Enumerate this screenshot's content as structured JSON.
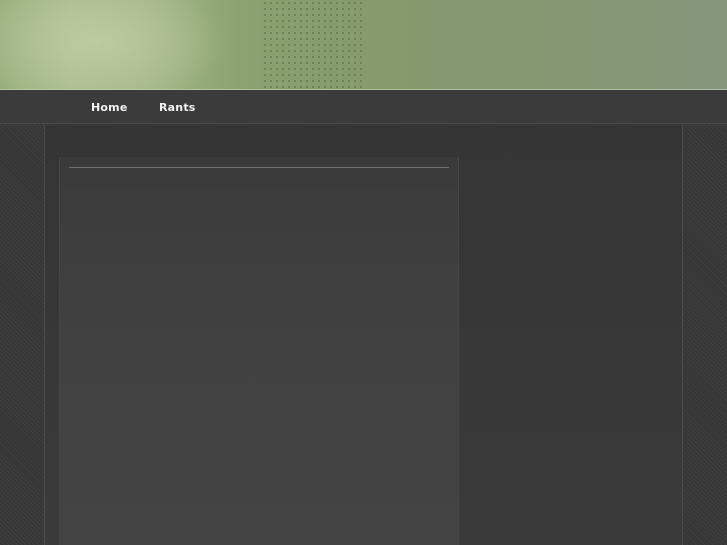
{
  "nav": {
    "items": [
      {
        "label": "Home"
      },
      {
        "label": "Rants"
      }
    ]
  },
  "colors": {
    "header_green": "#a3b687",
    "nav_bg": "#3b3b3b",
    "page_bg": "#363636",
    "panel_bg": "#444444",
    "nav_text": "#f2f2f2"
  }
}
